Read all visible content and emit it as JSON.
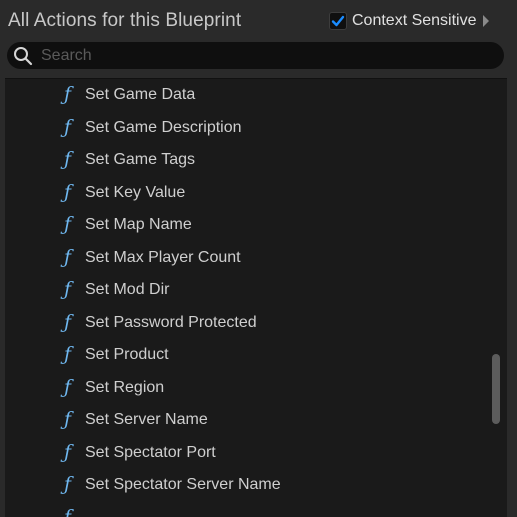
{
  "header": {
    "title": "All Actions for this Blueprint",
    "context_sensitive": {
      "label": "Context Sensitive",
      "checked": true
    }
  },
  "search": {
    "placeholder": "Search",
    "value": ""
  },
  "actions": {
    "icon": "function-icon",
    "icon_glyph": "ƒ",
    "items": [
      {
        "label": "Set Game Data"
      },
      {
        "label": "Set Game Description"
      },
      {
        "label": "Set Game Tags"
      },
      {
        "label": "Set Key Value"
      },
      {
        "label": "Set Map Name"
      },
      {
        "label": "Set Max Player Count"
      },
      {
        "label": "Set Mod Dir"
      },
      {
        "label": "Set Password Protected"
      },
      {
        "label": "Set Product"
      },
      {
        "label": "Set Region"
      },
      {
        "label": "Set Server Name"
      },
      {
        "label": "Set Spectator Port"
      },
      {
        "label": "Set Spectator Server Name"
      },
      {
        "label": ""
      }
    ]
  },
  "colors": {
    "accent": "#1a8cff",
    "function_icon": "#6fb7ef",
    "panel_bg": "#2a2a2a",
    "list_bg": "#1a1a1a"
  }
}
